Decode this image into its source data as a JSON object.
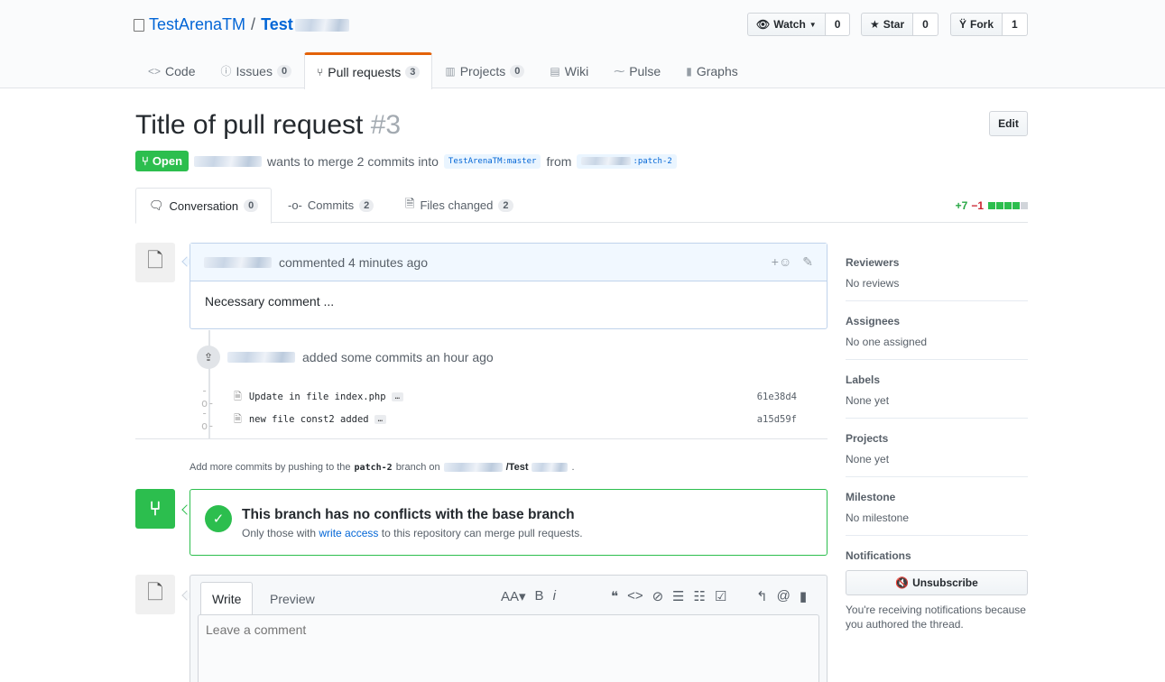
{
  "repo": {
    "owner": "TestArenaTM",
    "separator": "/",
    "name": "Test"
  },
  "actions": {
    "watch_label": "Watch",
    "watch_count": "0",
    "star_label": "Star",
    "star_count": "0",
    "fork_label": "Fork",
    "fork_count": "1"
  },
  "nav": {
    "code": "Code",
    "issues": "Issues",
    "issues_count": "0",
    "pulls": "Pull requests",
    "pulls_count": "3",
    "projects": "Projects",
    "projects_count": "0",
    "wiki": "Wiki",
    "pulse": "Pulse",
    "graphs": "Graphs"
  },
  "pr": {
    "title": "Title of pull request",
    "number": "#3",
    "edit_label": "Edit",
    "state": "Open",
    "merge_text": "wants to merge 2 commits into",
    "base_ref": "TestArenaTM:master",
    "from_text": "from",
    "head_ref": ":patch-2"
  },
  "tabs": {
    "conversation": "Conversation",
    "conversation_count": "0",
    "commits": "Commits",
    "commits_count": "2",
    "files": "Files changed",
    "files_count": "2",
    "additions": "+7",
    "deletions": "−1"
  },
  "comment": {
    "header": "commented 4 minutes ago",
    "body": "Necessary comment ..."
  },
  "commits": {
    "header": "added some commits an hour ago",
    "items": [
      {
        "message": "Update in file index.php",
        "ellipsis": "…",
        "sha": "61e38d4"
      },
      {
        "message": "new file const2 added",
        "ellipsis": "…",
        "sha": "a15d59f"
      }
    ]
  },
  "push_note": {
    "prefix": "Add more commits by pushing to the",
    "branch": "patch-2",
    "middle": "branch on",
    "repo": "/Test",
    "suffix": "."
  },
  "merge": {
    "title": "This branch has no conflicts with the base branch",
    "sub_prefix": "Only those with",
    "sub_link": "write access",
    "sub_suffix": "to this repository can merge pull requests."
  },
  "composer": {
    "write_tab": "Write",
    "preview_tab": "Preview",
    "placeholder": "Leave a comment"
  },
  "sidebar": {
    "reviewers_h": "Reviewers",
    "reviewers_v": "No reviews",
    "assignees_h": "Assignees",
    "assignees_v": "No one assigned",
    "labels_h": "Labels",
    "labels_v": "None yet",
    "projects_h": "Projects",
    "projects_v": "None yet",
    "milestone_h": "Milestone",
    "milestone_v": "No milestone",
    "notifications_h": "Notifications",
    "unsubscribe_label": "Unsubscribe",
    "notifications_note": "You're receiving notifications because you authored the thread."
  },
  "colors": {
    "accent": "#0366d6",
    "success": "#2cbe4e",
    "nav_selected": "#e36209"
  }
}
